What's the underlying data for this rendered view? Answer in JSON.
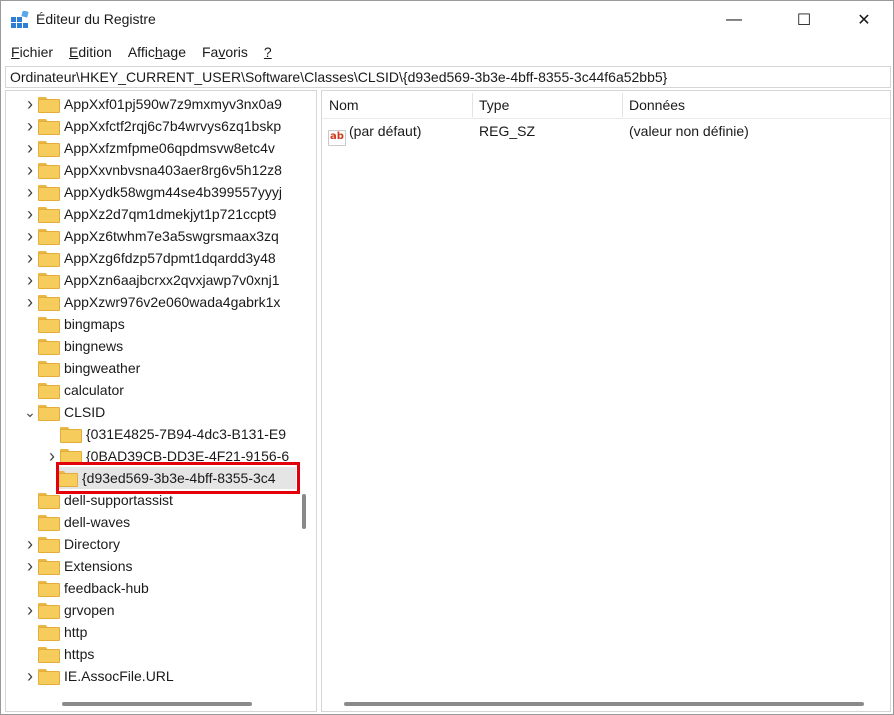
{
  "window": {
    "title": "Éditeur du Registre",
    "icon": "registry-editor-icon",
    "controls": {
      "minimize": "—",
      "maximize": "☐",
      "close": "✕"
    }
  },
  "menu": [
    {
      "label": "Fichier",
      "access": "F",
      "rest": "ichier"
    },
    {
      "label": "Edition",
      "access": "E",
      "rest": "dition"
    },
    {
      "label": "Affichage",
      "access": "",
      "pre": "Affic",
      "mid": "h",
      "post": "age"
    },
    {
      "label": "Favoris",
      "access": "",
      "pre": "Fa",
      "mid": "v",
      "post": "oris"
    },
    {
      "label": "?",
      "access": "?",
      "rest": ""
    }
  ],
  "address": "Ordinateur\\HKEY_CURRENT_USER\\Software\\Classes\\CLSID\\{d93ed569-3b3e-4bff-8355-3c44f6a52bb5}",
  "tree": {
    "items": [
      {
        "label": "AppXxf01pj590w7z9mxmyv3nx0a9",
        "expandable": true,
        "level": 1
      },
      {
        "label": "AppXxfctf2rqj6c7b4wrvys6zq1bskp",
        "expandable": true,
        "level": 1
      },
      {
        "label": "AppXxfzmfpme06qpdmsvw8etc4v",
        "expandable": true,
        "level": 1
      },
      {
        "label": "AppXxvnbvsna403aer8rg6v5h12z8",
        "expandable": true,
        "level": 1
      },
      {
        "label": "AppXydk58wgm44se4b399557yyyj",
        "expandable": true,
        "level": 1
      },
      {
        "label": "AppXz2d7qm1dmekjyt1p721ccpt9",
        "expandable": true,
        "level": 1
      },
      {
        "label": "AppXz6twhm7e3a5swgrsmaax3zq",
        "expandable": true,
        "level": 1
      },
      {
        "label": "AppXzg6fdzp57dpmt1dqardd3y48",
        "expandable": true,
        "level": 1
      },
      {
        "label": "AppXzn6aajbcrxx2qvxjawp7v0xnj1",
        "expandable": true,
        "level": 1
      },
      {
        "label": "AppXzwr976v2e060wada4gabrk1x",
        "expandable": true,
        "level": 1
      },
      {
        "label": "bingmaps",
        "expandable": false,
        "level": 1
      },
      {
        "label": "bingnews",
        "expandable": false,
        "level": 1
      },
      {
        "label": "bingweather",
        "expandable": false,
        "level": 1
      },
      {
        "label": "calculator",
        "expandable": false,
        "level": 1
      },
      {
        "label": "CLSID",
        "expandable": true,
        "expanded": true,
        "level": 1
      },
      {
        "label": "{031E4825-7B94-4dc3-B131-E9",
        "expandable": false,
        "level": 2
      },
      {
        "label": "{0BAD39CB-DD3E-4F21-9156-6",
        "expandable": true,
        "level": 2
      },
      {
        "label": "{d93ed569-3b3e-4bff-8355-3c4",
        "expandable": false,
        "level": 2,
        "selected": true
      },
      {
        "label": "dell-supportassist",
        "expandable": false,
        "level": 1
      },
      {
        "label": "dell-waves",
        "expandable": false,
        "level": 1
      },
      {
        "label": "Directory",
        "expandable": true,
        "level": 1
      },
      {
        "label": "Extensions",
        "expandable": true,
        "level": 1
      },
      {
        "label": "feedback-hub",
        "expandable": false,
        "level": 1
      },
      {
        "label": "grvopen",
        "expandable": true,
        "level": 1
      },
      {
        "label": "http",
        "expandable": false,
        "level": 1
      },
      {
        "label": "https",
        "expandable": false,
        "level": 1
      },
      {
        "label": "IE.AssocFile.URL",
        "expandable": true,
        "level": 1
      }
    ]
  },
  "list": {
    "columns": [
      "Nom",
      "Type",
      "Données"
    ],
    "rows": [
      {
        "name": "(par défaut)",
        "type": "REG_SZ",
        "data": "(valeur non définie)",
        "icon": "ab"
      }
    ]
  },
  "colors": {
    "highlight": "#e3000b",
    "folder": "#f6cd5c",
    "selected_bg": "#e5e5e5"
  }
}
